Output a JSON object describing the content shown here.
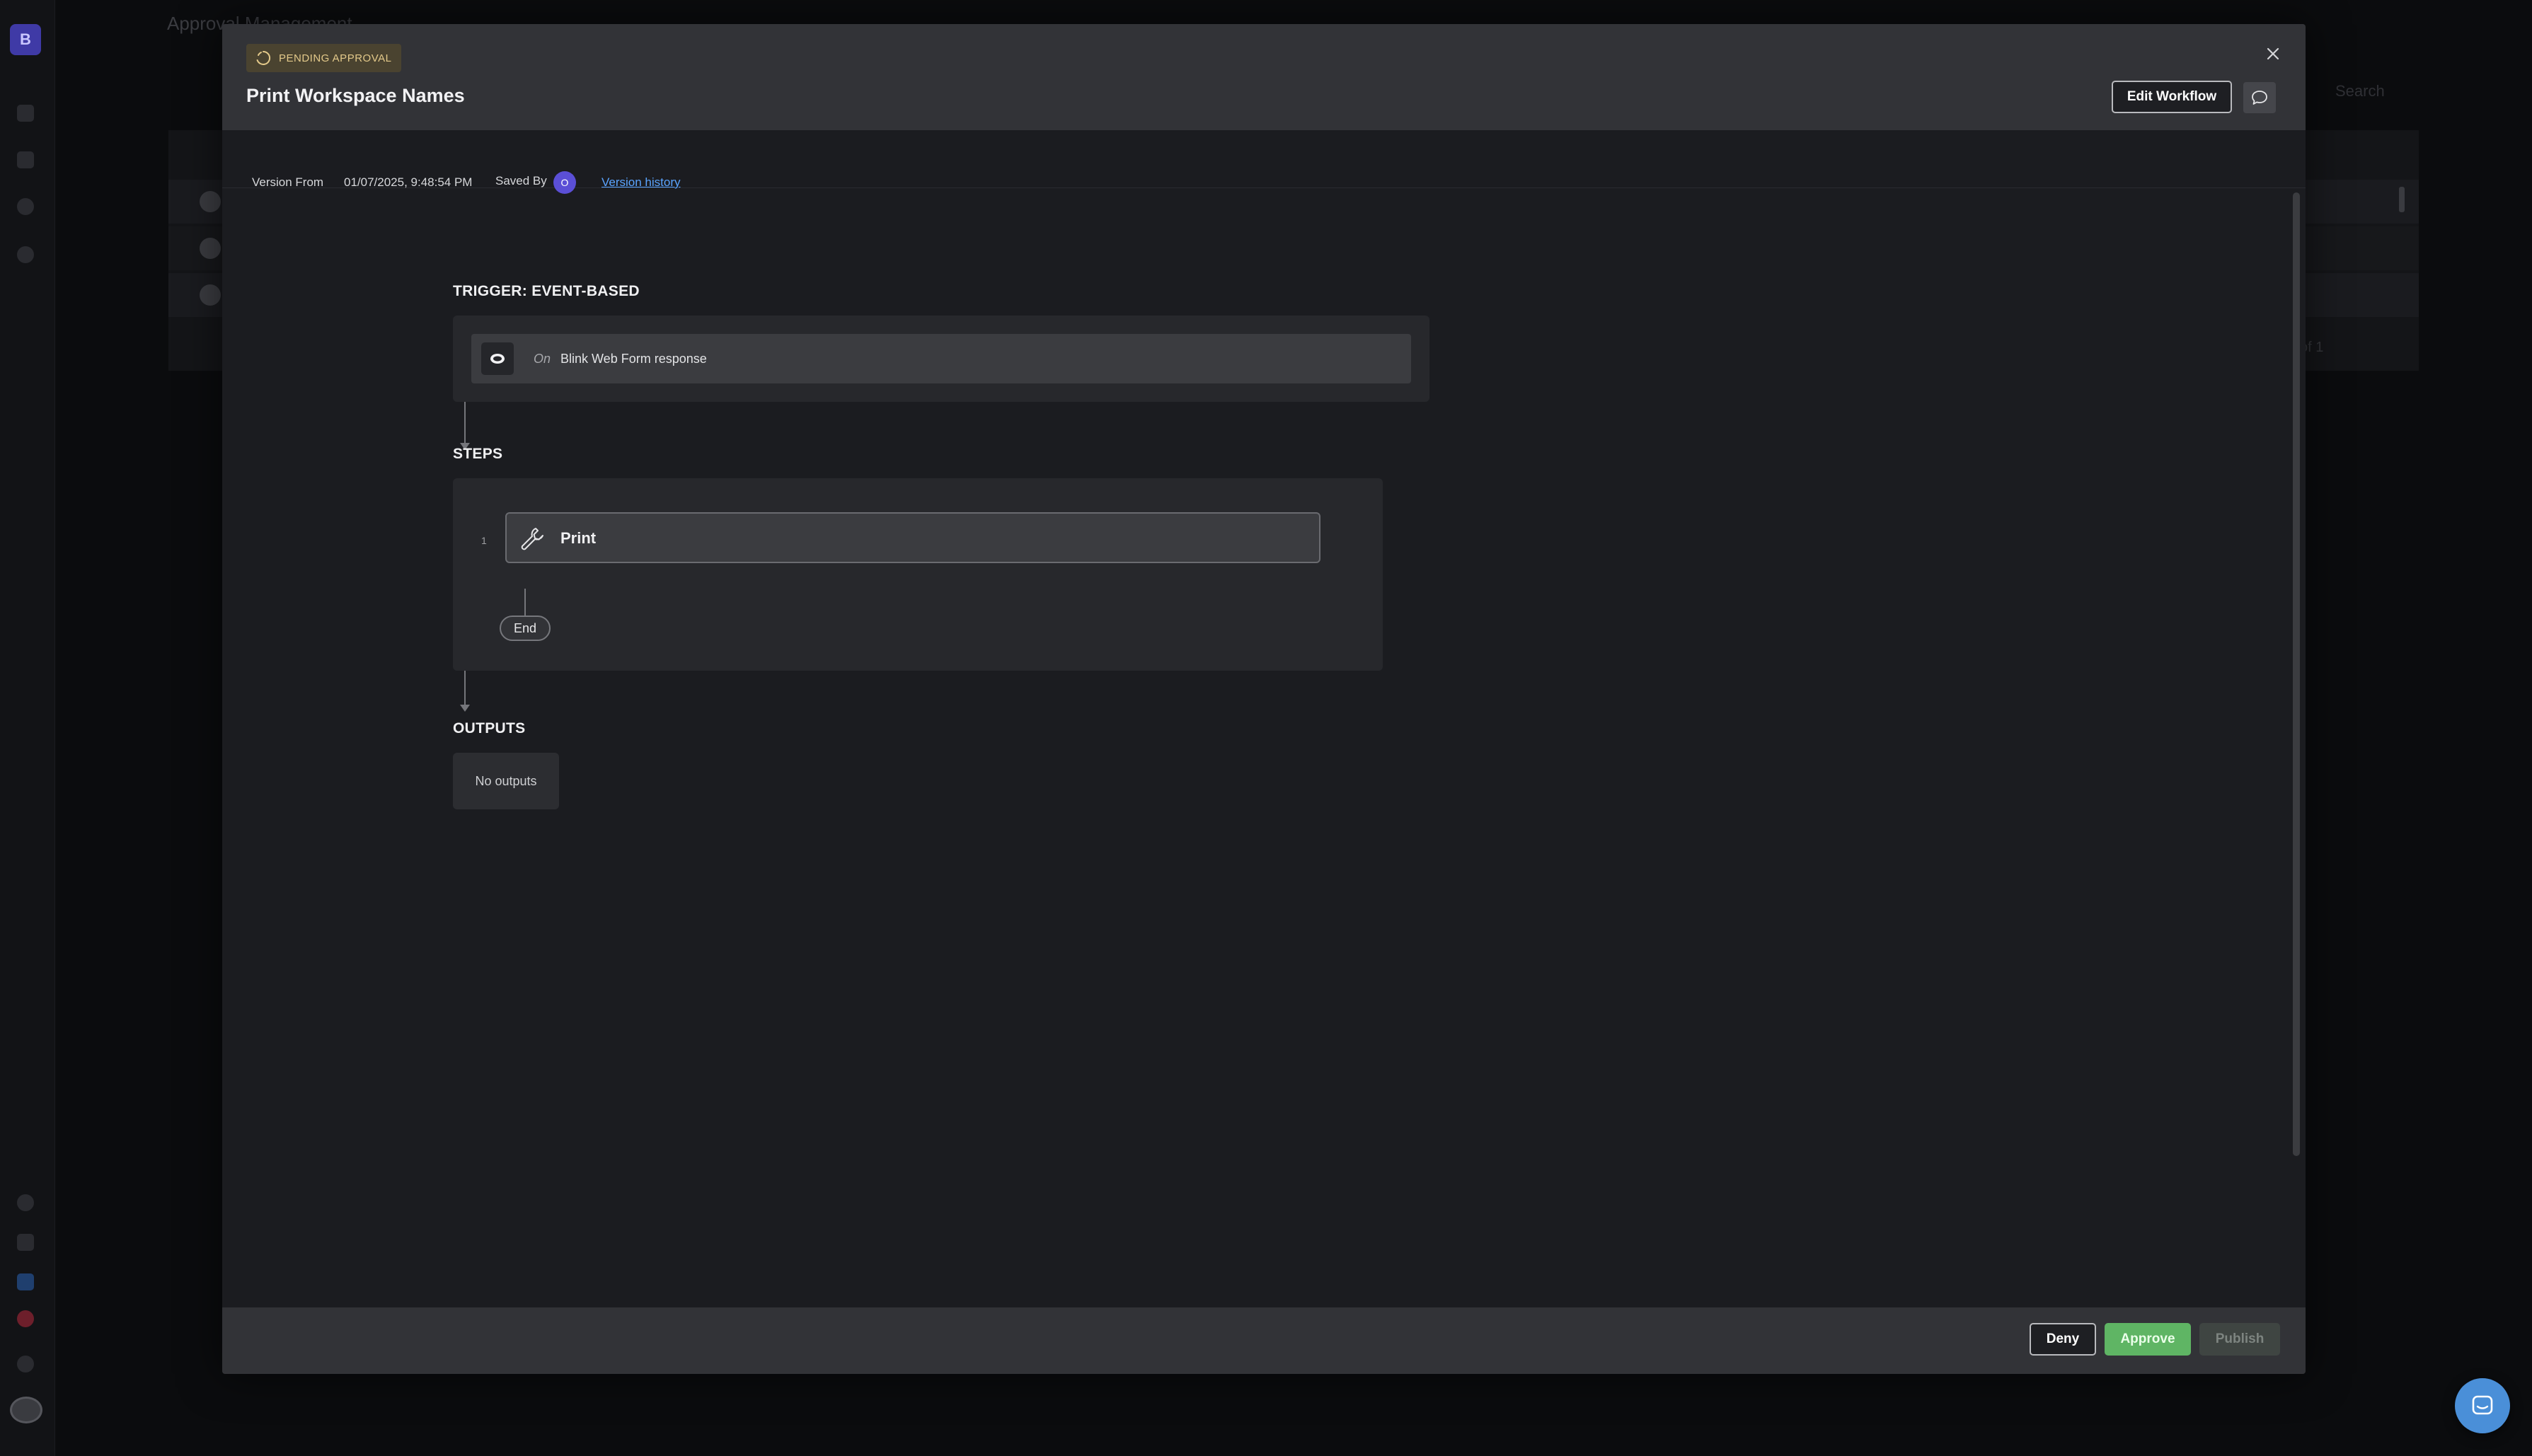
{
  "background_app": {
    "logo_letter": "B",
    "page_title": "Approval Management",
    "search_placeholder": "Search",
    "pager_text": "of 1"
  },
  "modal": {
    "status_badge": "PENDING APPROVAL",
    "title": "Print Workspace Names",
    "edit_button": "Edit Workflow",
    "meta": {
      "version_from_label": "Version From",
      "version_timestamp": "01/07/2025, 9:48:54 PM",
      "saved_by_label": "Saved By",
      "saved_by_initial": "O",
      "version_history_link": "Version history"
    },
    "trigger": {
      "heading": "TRIGGER: EVENT-BASED",
      "on_label": "On",
      "event_text": "Blink Web Form response"
    },
    "steps": {
      "heading": "STEPS",
      "items": [
        {
          "number": "1",
          "label": "Print",
          "icon": "wrench-icon"
        }
      ],
      "end_label": "End"
    },
    "outputs": {
      "heading": "OUTPUTS",
      "empty_text": "No outputs"
    },
    "footer": {
      "deny_button": "Deny",
      "approve_button": "Approve",
      "publish_button": "Publish"
    }
  },
  "colors": {
    "approve": "#5fb564",
    "badge_bg": "#4a4330",
    "badge_text": "#e3c98a",
    "link": "#5aa4ff",
    "avatar": "#5b4fd6",
    "chat_fab": "#4a8fd8"
  }
}
